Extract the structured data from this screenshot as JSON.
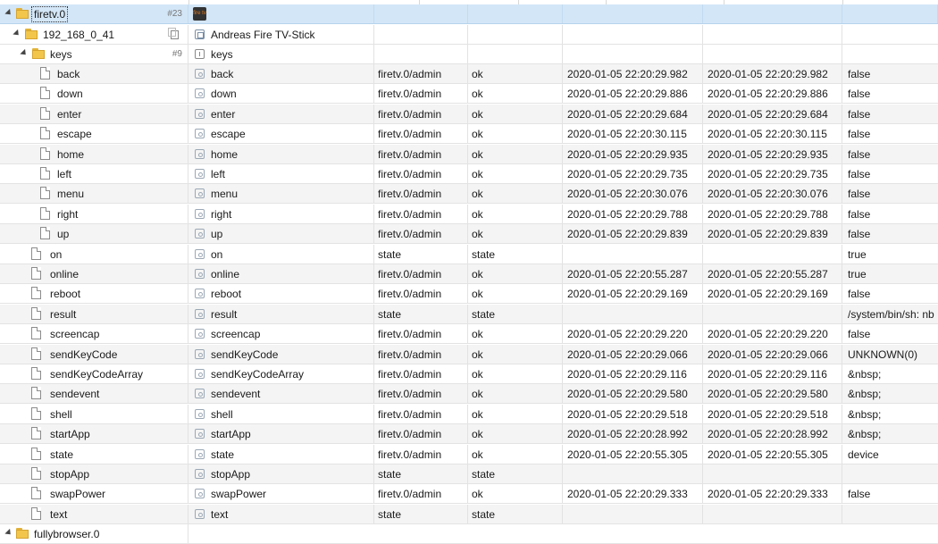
{
  "tree": {
    "root": {
      "name": "firetv.0",
      "count": "#23",
      "icon": "fire-tv-stick-icon",
      "badge": "fire tv"
    },
    "device": {
      "name": "192_168_0_41",
      "label": "Andreas Fire TV-Stick"
    },
    "keys_folder": {
      "name": "keys",
      "count": "#9",
      "label": "keys"
    },
    "rows": [
      [
        "back",
        "back",
        "firetv.0/admin",
        "ok",
        "2020-01-05 22:20:29.982",
        "2020-01-05 22:20:29.982",
        "false"
      ],
      [
        "down",
        "down",
        "firetv.0/admin",
        "ok",
        "2020-01-05 22:20:29.886",
        "2020-01-05 22:20:29.886",
        "false"
      ],
      [
        "enter",
        "enter",
        "firetv.0/admin",
        "ok",
        "2020-01-05 22:20:29.684",
        "2020-01-05 22:20:29.684",
        "false"
      ],
      [
        "escape",
        "escape",
        "firetv.0/admin",
        "ok",
        "2020-01-05 22:20:30.115",
        "2020-01-05 22:20:30.115",
        "false"
      ],
      [
        "home",
        "home",
        "firetv.0/admin",
        "ok",
        "2020-01-05 22:20:29.935",
        "2020-01-05 22:20:29.935",
        "false"
      ],
      [
        "left",
        "left",
        "firetv.0/admin",
        "ok",
        "2020-01-05 22:20:29.735",
        "2020-01-05 22:20:29.735",
        "false"
      ],
      [
        "menu",
        "menu",
        "firetv.0/admin",
        "ok",
        "2020-01-05 22:20:30.076",
        "2020-01-05 22:20:30.076",
        "false"
      ],
      [
        "right",
        "right",
        "firetv.0/admin",
        "ok",
        "2020-01-05 22:20:29.788",
        "2020-01-05 22:20:29.788",
        "false"
      ],
      [
        "up",
        "up",
        "firetv.0/admin",
        "ok",
        "2020-01-05 22:20:29.839",
        "2020-01-05 22:20:29.839",
        "false"
      ],
      [
        "on",
        "on",
        "state",
        "state",
        "",
        "",
        "true"
      ],
      [
        "online",
        "online",
        "firetv.0/admin",
        "ok",
        "2020-01-05 22:20:55.287",
        "2020-01-05 22:20:55.287",
        "true"
      ],
      [
        "reboot",
        "reboot",
        "firetv.0/admin",
        "ok",
        "2020-01-05 22:20:29.169",
        "2020-01-05 22:20:29.169",
        "false"
      ],
      [
        "result",
        "result",
        "state",
        "state",
        "",
        "",
        "/system/bin/sh: nb"
      ],
      [
        "screencap",
        "screencap",
        "firetv.0/admin",
        "ok",
        "2020-01-05 22:20:29.220",
        "2020-01-05 22:20:29.220",
        "false"
      ],
      [
        "sendKeyCode",
        "sendKeyCode",
        "firetv.0/admin",
        "ok",
        "2020-01-05 22:20:29.066",
        "2020-01-05 22:20:29.066",
        "UNKNOWN(0)"
      ],
      [
        "sendKeyCodeArray",
        "sendKeyCodeArray",
        "firetv.0/admin",
        "ok",
        "2020-01-05 22:20:29.116",
        "2020-01-05 22:20:29.116",
        "&nbsp;"
      ],
      [
        "sendevent",
        "sendevent",
        "firetv.0/admin",
        "ok",
        "2020-01-05 22:20:29.580",
        "2020-01-05 22:20:29.580",
        "&nbsp;"
      ],
      [
        "shell",
        "shell",
        "firetv.0/admin",
        "ok",
        "2020-01-05 22:20:29.518",
        "2020-01-05 22:20:29.518",
        "&nbsp;"
      ],
      [
        "startApp",
        "startApp",
        "firetv.0/admin",
        "ok",
        "2020-01-05 22:20:28.992",
        "2020-01-05 22:20:28.992",
        "&nbsp;"
      ],
      [
        "state",
        "state",
        "firetv.0/admin",
        "ok",
        "2020-01-05 22:20:55.305",
        "2020-01-05 22:20:55.305",
        "device"
      ],
      [
        "stopApp",
        "stopApp",
        "state",
        "state",
        "",
        "",
        ""
      ],
      [
        "swapPower",
        "swapPower",
        "firetv.0/admin",
        "ok",
        "2020-01-05 22:20:29.333",
        "2020-01-05 22:20:29.333",
        "false"
      ],
      [
        "text",
        "text",
        "state",
        "state",
        "",
        "",
        ""
      ]
    ],
    "partial_next": {
      "name": "fullybrowser.0"
    }
  },
  "colors": {
    "selected_row": "#d3e6f7",
    "folder": "#f2c64b"
  }
}
